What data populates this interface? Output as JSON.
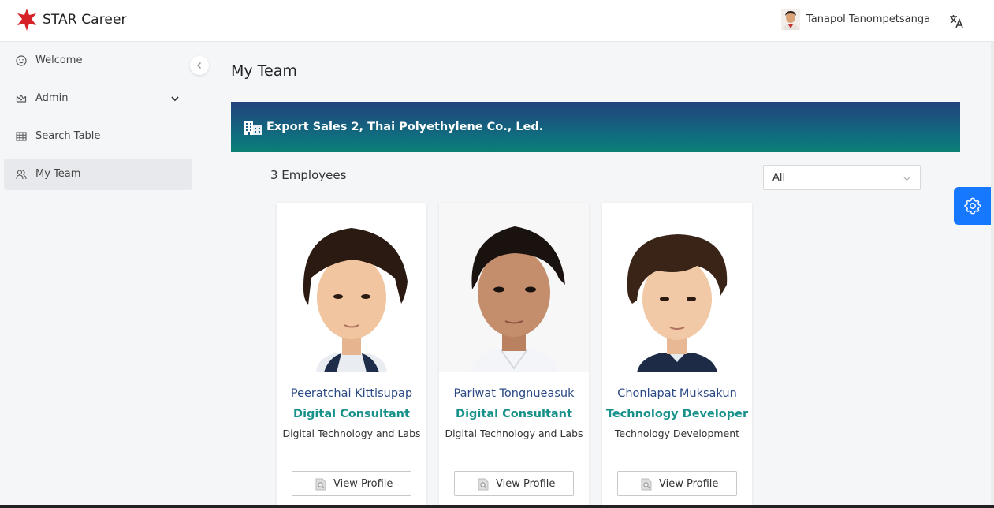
{
  "header": {
    "brand": "STAR Career",
    "user_name": "Tanapol Tanompetsanga",
    "logo_icon": "star-logo-icon",
    "lang_icon": "translate-icon"
  },
  "sidebar": {
    "items": [
      {
        "label": "Welcome",
        "icon": "smile-icon"
      },
      {
        "label": "Admin",
        "icon": "crown-icon",
        "expandable": true
      },
      {
        "label": "Search Table",
        "icon": "table-icon"
      },
      {
        "label": "My Team",
        "icon": "team-icon",
        "active": true
      }
    ]
  },
  "main": {
    "title": "My Team",
    "department": "Export Sales 2, Thai Polyethylene Co., Led.",
    "employee_count": "3 Employees",
    "filter_value": "All"
  },
  "employees": [
    {
      "name": "Peeratchai Kittisupap",
      "role": "Digital Consultant",
      "dept": "Digital Technology and Labs",
      "button": "View Profile"
    },
    {
      "name": "Pariwat Tongnueasuk",
      "role": "Digital Consultant",
      "dept": "Digital Technology and Labs",
      "button": "View Profile"
    },
    {
      "name": "Chonlapat Muksakun",
      "role": "Technology Developer",
      "dept": "Technology Development",
      "button": "View Profile"
    }
  ],
  "colors": {
    "accent": "#1677ff",
    "banner_top": "#23427e",
    "banner_bottom": "#0b8075",
    "name_color": "#2b4a84",
    "role_color": "#17918a"
  }
}
